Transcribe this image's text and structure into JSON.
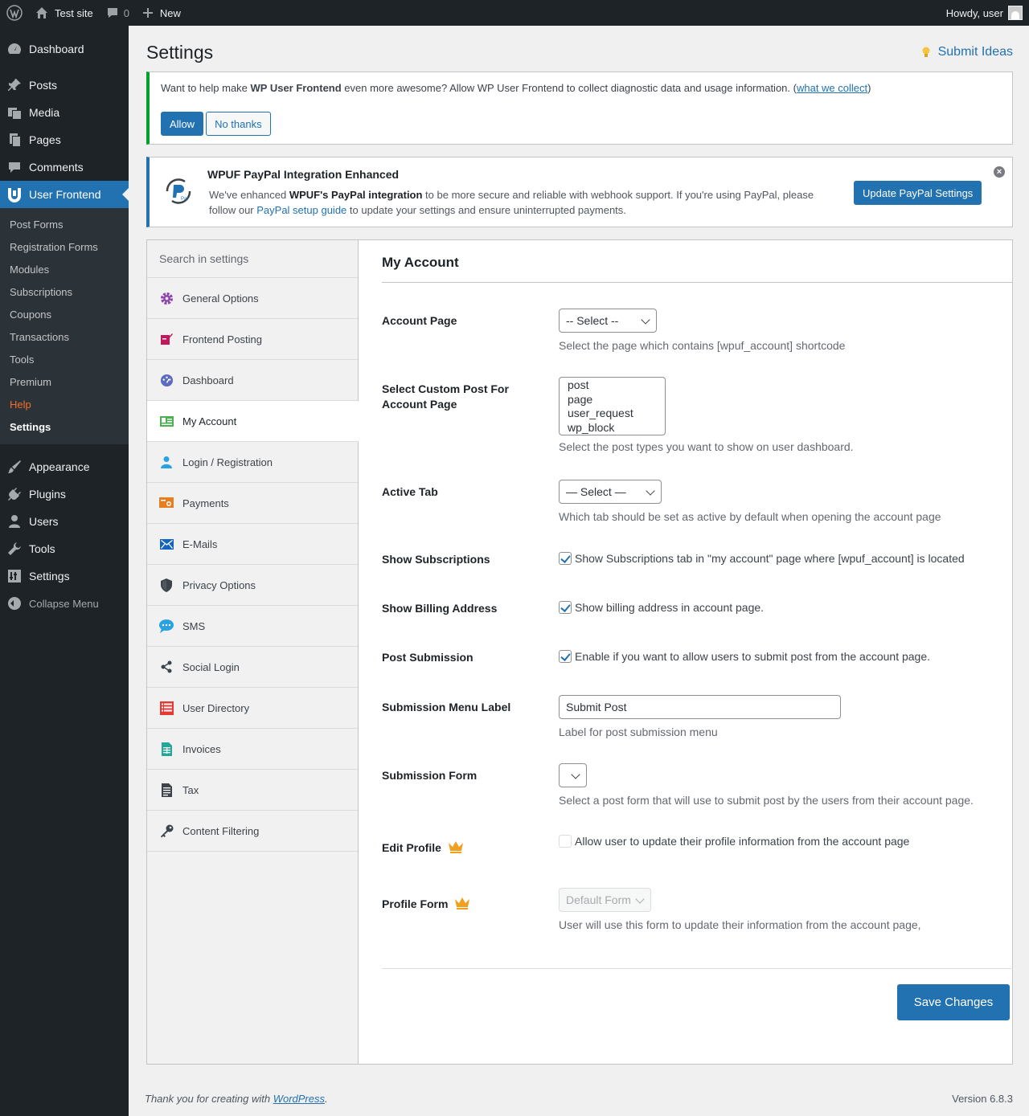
{
  "adminbar": {
    "site_name": "Test site",
    "comments_count": "0",
    "new_label": "New",
    "howdy": "Howdy, user"
  },
  "menu": {
    "items_top": [
      {
        "label": "Dashboard",
        "icon": "dashboard-icon"
      },
      {
        "label": "Posts",
        "icon": "pin-icon"
      },
      {
        "label": "Media",
        "icon": "media-icon"
      },
      {
        "label": "Pages",
        "icon": "pages-icon"
      },
      {
        "label": "Comments",
        "icon": "comment-icon"
      }
    ],
    "current": {
      "label": "User Frontend",
      "icon": "user-frontend-icon"
    },
    "submenu": [
      "Post Forms",
      "Registration Forms",
      "Modules",
      "Subscriptions",
      "Coupons",
      "Transactions",
      "Tools",
      "Premium",
      "Help",
      "Settings"
    ],
    "items_bottom": [
      {
        "label": "Appearance",
        "icon": "brush-icon"
      },
      {
        "label": "Plugins",
        "icon": "plug-icon"
      },
      {
        "label": "Users",
        "icon": "users-icon"
      },
      {
        "label": "Tools",
        "icon": "wrench-icon"
      },
      {
        "label": "Settings",
        "icon": "settings-icon"
      }
    ],
    "collapse": "Collapse Menu"
  },
  "page": {
    "title": "Settings",
    "submit_ideas": "Submit Ideas"
  },
  "notice_tracking": {
    "text_pre": "Want to help make ",
    "text_bold": "WP User Frontend",
    "text_post": " even more awesome? Allow WP User Frontend to collect diagnostic data and usage information. (",
    "link": "what we collect",
    "text_end": ")",
    "allow": "Allow",
    "no_thanks": "No thanks"
  },
  "notice_paypal": {
    "title": "WPUF PayPal Integration Enhanced",
    "text_1": "We've enhanced ",
    "text_bold": "WPUF's PayPal integration",
    "text_2": " to be more secure and reliable with webhook support. If you're using PayPal, please follow our ",
    "link": "PayPal setup guide",
    "text_3": " to update your settings and ensure uninterrupted payments.",
    "button": "Update PayPal Settings"
  },
  "settings_nav": {
    "search_placeholder": "Search in settings",
    "items": [
      {
        "label": "General Options",
        "icon": "gear-icon",
        "color": "#8e44ad"
      },
      {
        "label": "Frontend Posting",
        "icon": "edit-icon",
        "color": "#c2185b"
      },
      {
        "label": "Dashboard",
        "icon": "dashboard-gauge-icon",
        "color": "#5c6bc0"
      },
      {
        "label": "My Account",
        "icon": "account-card-icon",
        "color": "#4caf50"
      },
      {
        "label": "Login / Registration",
        "icon": "user-icon",
        "color": "#29a3e0"
      },
      {
        "label": "Payments",
        "icon": "payment-icon",
        "color": "#e67e22"
      },
      {
        "label": "E-Mails",
        "icon": "envelope-icon",
        "color": "#1565c0"
      },
      {
        "label": "Privacy Options",
        "icon": "shield-icon",
        "color": "#3c434a"
      },
      {
        "label": "SMS",
        "icon": "sms-bubble-icon",
        "color": "#29a3e0"
      },
      {
        "label": "Social Login",
        "icon": "share-icon",
        "color": "#3c434a"
      },
      {
        "label": "User Directory",
        "icon": "list-icon",
        "color": "#e53935"
      },
      {
        "label": "Invoices",
        "icon": "invoice-icon",
        "color": "#26a69a"
      },
      {
        "label": "Tax",
        "icon": "document-icon",
        "color": "#3c434a"
      },
      {
        "label": "Content Filtering",
        "icon": "key-icon",
        "color": "#3c434a"
      }
    ]
  },
  "panel": {
    "title": "My Account",
    "account_page": {
      "label": "Account Page",
      "value": "-- Select --",
      "desc": "Select the page which contains [wpuf_account] shortcode"
    },
    "custom_post": {
      "label": "Select Custom Post For Account Page",
      "options": [
        "post",
        "page",
        "user_request",
        "wp_block"
      ],
      "desc": "Select the post types you want to show on user dashboard."
    },
    "active_tab": {
      "label": "Active Tab",
      "value": "— Select —",
      "desc": "Which tab should be set as active by default when opening the account page"
    },
    "show_subscriptions": {
      "label": "Show Subscriptions",
      "text": "Show Subscriptions tab in \"my account\" page where [wpuf_account] is located",
      "checked": true
    },
    "show_billing": {
      "label": "Show Billing Address",
      "text": "Show billing address in account page.",
      "checked": true
    },
    "post_submission": {
      "label": "Post Submission",
      "text": "Enable if you want to allow users to submit post from the account page.",
      "checked": true
    },
    "submission_label": {
      "label": "Submission Menu Label",
      "value": "Submit Post",
      "desc": "Label for post submission menu"
    },
    "submission_form": {
      "label": "Submission Form",
      "value": "",
      "desc": "Select a post form that will use to submit post by the users from their account page."
    },
    "edit_profile": {
      "label": "Edit Profile",
      "text": "Allow user to update their profile information from the account page",
      "checked": false
    },
    "profile_form": {
      "label": "Profile Form",
      "value": "Default Form",
      "desc": "User will use this form to update their information from the account page,"
    },
    "save": "Save Changes",
    "accent_color": "#2271b1",
    "crown_color": "#f0a020"
  },
  "footer": {
    "thanks_pre": "Thank you for creating with ",
    "thanks_link": "WordPress",
    "thanks_post": ".",
    "version": "Version 6.8.3"
  }
}
